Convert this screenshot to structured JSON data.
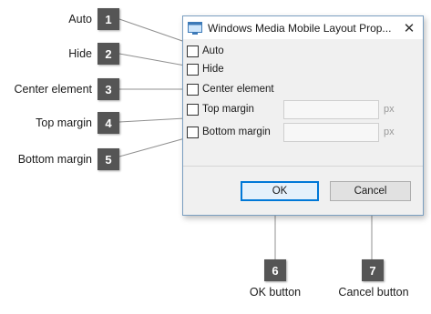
{
  "callouts": [
    {
      "number": "1",
      "label": "Auto"
    },
    {
      "number": "2",
      "label": "Hide"
    },
    {
      "number": "3",
      "label": "Center element"
    },
    {
      "number": "4",
      "label": "Top margin"
    },
    {
      "number": "5",
      "label": "Bottom margin"
    },
    {
      "number": "6",
      "label": "OK button"
    },
    {
      "number": "7",
      "label": "Cancel button"
    }
  ],
  "dialog": {
    "title": "Windows Media Mobile Layout Prop...",
    "icon": "media-window-icon",
    "close_icon": "close-icon",
    "options": [
      {
        "label": "Auto",
        "checked": false
      },
      {
        "label": "Hide",
        "checked": false
      },
      {
        "label": "Center element",
        "checked": false
      },
      {
        "label": "Top margin",
        "checked": false,
        "value": "",
        "unit": "px"
      },
      {
        "label": "Bottom margin",
        "checked": false,
        "value": "",
        "unit": "px"
      }
    ],
    "ok_label": "OK",
    "cancel_label": "Cancel"
  },
  "colors": {
    "badge": "#555555",
    "default_button_border": "#0078d7",
    "dialog_border": "#7a9ec0"
  }
}
